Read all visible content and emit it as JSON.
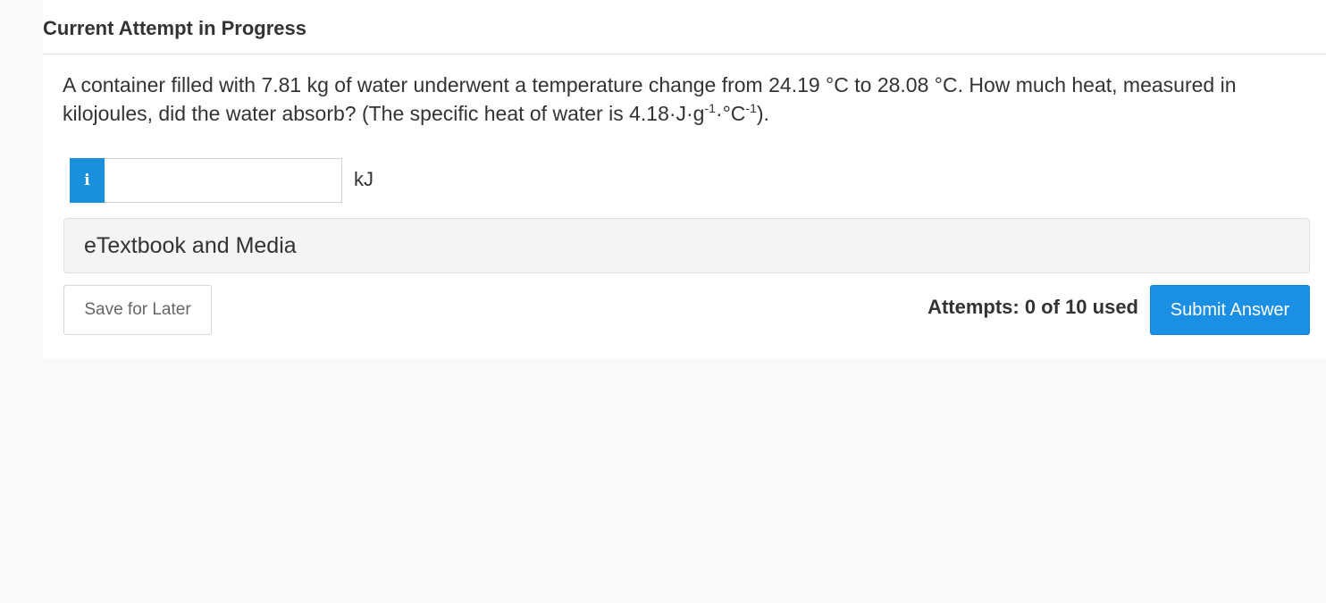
{
  "header": {
    "title": "Current Attempt in Progress"
  },
  "question": {
    "text_main": "A container filled with 7.81 kg of water underwent a temperature change from 24.19 °C to 28.08 °C. How much heat, measured in kilojoules, did the water absorb? (The specific heat of water is 4.18·J·g",
    "exp1": "-1",
    "mid": "·°C",
    "exp2": "-1",
    "tail": ")."
  },
  "answer": {
    "info_glyph": "i",
    "input_value": "",
    "input_placeholder": "",
    "unit": "kJ"
  },
  "etextbook": {
    "label": "eTextbook and Media"
  },
  "footer": {
    "save_label": "Save for Later",
    "attempts_text": "Attempts: 0 of 10 used",
    "submit_label": "Submit Answer"
  },
  "colors": {
    "accent": "#1a8fe3",
    "panel_background": "#ffffff",
    "page_background": "#fafafa"
  }
}
